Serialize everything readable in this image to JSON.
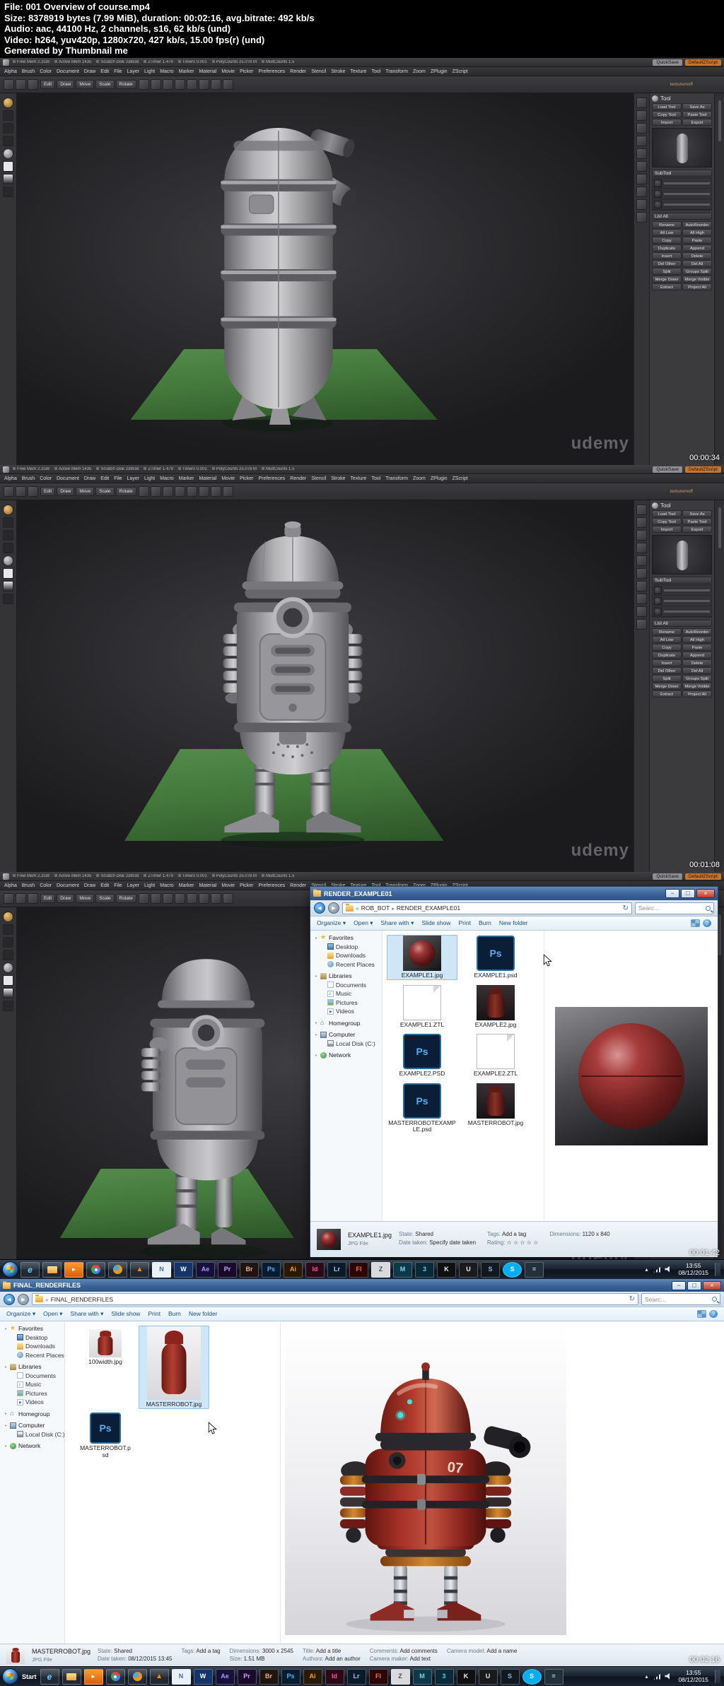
{
  "header": {
    "lines": [
      "File: 001 Overview of course.mp4",
      "Size: 8378919 bytes (7.99 MiB), duration: 00:02:16, avg.bitrate: 492 kb/s",
      "Audio: aac, 44100 Hz, 2 channels, s16, 62 kb/s (und)",
      "Video: h264, yuv420p, 1280x720, 427 kb/s, 15.00 fps(r) (und)",
      "Generated by Thumbnail me"
    ]
  },
  "frames": {
    "f1": {
      "timestamp": "00:00:34"
    },
    "f2": {
      "timestamp": "00:01:08"
    },
    "f3": {
      "timestamp": "00:01:42"
    },
    "f4": {
      "timestamp": "00:02:16"
    }
  },
  "zbrush": {
    "info": [
      "Free Mem 2.2GB",
      "Active Mem 1435",
      "Scratch Disk 238GB",
      "ZTimer 1.479",
      "Timers 0.001",
      "PolyCounts 25.078 M",
      "MultCounts 1.5"
    ],
    "chips": [
      {
        "t": "QuickSave",
        "cls": "grey",
        "n": "quicksave-button"
      },
      {
        "t": "DefaultZScript",
        "cls": "orange",
        "n": "default-zscript-button"
      }
    ],
    "menus": [
      "Alpha",
      "Brush",
      "Color",
      "Document",
      "Draw",
      "Edit",
      "File",
      "Layer",
      "Light",
      "Macro",
      "Marker",
      "Material",
      "Movie",
      "Picker",
      "Preferences",
      "Render",
      "Stencil",
      "Stroke",
      "Texture",
      "Tool",
      "Transform",
      "Zoom",
      "ZPlugin",
      "ZScript"
    ],
    "shelf_icons_a": [
      "projection-master-icon",
      "lightbox-icon",
      "quicksketch-icon"
    ],
    "shelf_buttons": [
      {
        "t": "Edit",
        "n": "edit-mode-button"
      },
      {
        "t": "Draw",
        "n": "draw-button"
      },
      {
        "t": "Move",
        "n": "move-button"
      },
      {
        "t": "Scale",
        "n": "scale-button"
      },
      {
        "t": "Rotate",
        "n": "rotate-button"
      }
    ],
    "shelf_icons_b": [
      "symmetry-icon",
      "polyframe-icon",
      "matcap-icon",
      "gradient-icon",
      "material-thumb-icon",
      "texture-thumb-icon",
      "alpha-thumb-icon",
      "stroke-thumb-icon"
    ],
    "texture_label": "texturemoff",
    "watermark": "udemy",
    "left_shelf": [
      {
        "n": "brush-icon",
        "cls": "gold"
      },
      {
        "n": "stroke-icon",
        "cls": "dark"
      },
      {
        "n": "alpha-icon",
        "cls": "dark"
      },
      {
        "n": "texture-icon",
        "cls": "dark"
      },
      {
        "n": "material-icon",
        "cls": "matcap"
      },
      {
        "n": "color-swatch-main",
        "cls": "white"
      },
      {
        "n": "color-gradient-swatch",
        "cls": "grad"
      },
      {
        "n": "color-picker-icon",
        "cls": "dark"
      }
    ],
    "right_shelf": [
      "scroll-icon",
      "zoom-icon",
      "actual-size-icon",
      "aa-half-icon",
      "perspective-icon",
      "floor-grid-icon",
      "local-symmetry-icon",
      "transparency-icon",
      "ghost-icon",
      "solo-icon"
    ],
    "tool": {
      "title": "Tool",
      "buttons": [
        "Load Tool",
        "Save As",
        "Copy Tool",
        "Paste Tool",
        "Import",
        "Export"
      ],
      "subtool_title": "SubTool",
      "subtools": [
        "subtool-slot-1",
        "subtool-slot-2",
        "subtool-slot-3"
      ],
      "list_all": "List All",
      "subtool_buttons": [
        "Rename",
        "AutoReorder",
        "All Low",
        "All High",
        "Copy",
        "Paste",
        "Duplicate",
        "Append",
        "Insert",
        "Delete",
        "Del Other",
        "Del All",
        "Split",
        "Groups Split",
        "Merge Down",
        "Merge Visible",
        "Extract",
        "Project All"
      ]
    }
  },
  "nav": [
    {
      "label": "Favorites",
      "cls": "root",
      "icon": "star-icon"
    },
    {
      "label": "Desktop",
      "cls": "child",
      "icon": "desktop-icon"
    },
    {
      "label": "Downloads",
      "cls": "child",
      "icon": "downloads-icon"
    },
    {
      "label": "Recent Places",
      "cls": "child",
      "icon": "recent-icon"
    },
    {
      "label": "Libraries",
      "cls": "root",
      "icon": "libraries-icon"
    },
    {
      "label": "Documents",
      "cls": "child",
      "icon": "documents-icon"
    },
    {
      "label": "Music",
      "cls": "child",
      "icon": "music-icon"
    },
    {
      "label": "Pictures",
      "cls": "child",
      "icon": "pictures-icon"
    },
    {
      "label": "Videos",
      "cls": "child",
      "icon": "videos-icon"
    },
    {
      "label": "Homegroup",
      "cls": "root",
      "icon": "homegroup-icon"
    },
    {
      "label": "Computer",
      "cls": "root",
      "icon": "computer-icon"
    },
    {
      "label": "Local Disk (C:)",
      "cls": "child",
      "icon": "disk-icon"
    },
    {
      "label": "Network",
      "cls": "root",
      "icon": "network-icon"
    }
  ],
  "explorer1": {
    "title": "RENDER_EXAMPLE01",
    "crumb_prefix": "«",
    "crumbs": [
      {
        "t": "ROB_BOT"
      },
      {
        "t": "RENDER_EXAMPLE01"
      }
    ],
    "search": "Searc...",
    "toolbar": [
      "Organize ▾",
      "Open ▾",
      "Share with ▾",
      "Slide show",
      "Print",
      "Burn",
      "New folder"
    ],
    "files": [
      {
        "name": "EXAMPLE1.jpg",
        "kind": "art-sphere",
        "badge": "",
        "selected": true
      },
      {
        "name": "EXAMPLE1.psd",
        "kind": "art-psd",
        "badge": "Ps",
        "selected": false
      },
      {
        "name": "EXAMPLE1.ZTL",
        "kind": "art-ztl",
        "badge": "",
        "selected": false
      },
      {
        "name": "EXAMPLE2.jpg",
        "kind": "art-robot-dark",
        "badge": "",
        "selected": false
      },
      {
        "name": "EXAMPLE2.PSD",
        "kind": "art-psd",
        "badge": "Ps",
        "selected": false
      },
      {
        "name": "EXAMPLE2.ZTL",
        "kind": "art-ztl",
        "badge": "",
        "selected": false
      },
      {
        "name": "MASTERROBOTEXAMPLE.psd",
        "kind": "art-psd",
        "badge": "Ps",
        "selected": false
      },
      {
        "name": "MASTERROBOT.jpg",
        "kind": "art-robot-dark",
        "badge": "",
        "selected": false
      }
    ],
    "details": {
      "name": "EXAMPLE1.jpg",
      "type": "JPG File",
      "fields": [
        {
          "l": "State:",
          "v": "Shared"
        },
        {
          "l": "Date taken:",
          "v": "Specify date taken"
        },
        {
          "l": "Tags:",
          "v": "Add a tag"
        },
        {
          "l": "Rating:",
          "v": "☆ ☆ ☆ ☆ ☆"
        },
        {
          "l": "Dimensions:",
          "v": "1120 x 840"
        }
      ]
    }
  },
  "explorer2": {
    "title": "FINAL_RENDERFILES",
    "crumb_prefix": "«",
    "crumbs": [
      {
        "t": "FINAL_RENDERFILES"
      }
    ],
    "search": "Searc...",
    "toolbar": [
      "Organize ▾",
      "Open ▾",
      "Share with ▾",
      "Slide show",
      "Print",
      "Burn",
      "New folder"
    ],
    "files": [
      {
        "name": "100width.jpg",
        "kind": "art-robot-light",
        "badge": "",
        "cls": "t-small",
        "selected": false
      },
      {
        "name": "MASTERROBOT.jpg",
        "kind": "art-robot-light",
        "badge": "",
        "cls": "t-big",
        "selected": true
      },
      {
        "name": "MASTERROBOT.psd",
        "kind": "art-psd",
        "badge": "Ps",
        "cls": "t-psd",
        "selected": false
      }
    ],
    "details": {
      "name": "MASTERROBOT.jpg",
      "type": "JPG File",
      "fields": [
        {
          "l": "State:",
          "v": "Shared"
        },
        {
          "l": "Date taken:",
          "v": "08/12/2015 13:45"
        },
        {
          "l": "Tags:",
          "v": "Add a tag"
        },
        {
          "l": "",
          "v": ""
        },
        {
          "l": "Dimensions:",
          "v": "3000 x 2545"
        },
        {
          "l": "Size:",
          "v": "1.51 MB"
        },
        {
          "l": "Title:",
          "v": "Add a title"
        },
        {
          "l": "Authors:",
          "v": "Add an author"
        },
        {
          "l": "Comments:",
          "v": "Add comments"
        },
        {
          "l": "Camera maker:",
          "v": "Add text"
        },
        {
          "l": "Camera model:",
          "v": "Add a name"
        }
      ]
    }
  },
  "render": {
    "decal": "07"
  },
  "taskbar": {
    "start_label": "Start",
    "time": "13:55",
    "date": "08/12/2015",
    "icons": [
      {
        "n": "internet-explorer-icon",
        "t": "e",
        "cls": "ie"
      },
      {
        "n": "windows-explorer-icon",
        "t": "",
        "cls": "folder"
      },
      {
        "n": "media-player-icon",
        "t": "►",
        "cls": "wmp"
      },
      {
        "n": "chrome-icon",
        "t": "",
        "cls": "chrome"
      },
      {
        "n": "firefox-icon",
        "t": "",
        "cls": "firefox"
      },
      {
        "n": "vlc-icon",
        "t": "▲",
        "cls": "vlc"
      },
      {
        "n": "notepad-icon",
        "t": "N",
        "cls": "notepad"
      },
      {
        "n": "word-icon",
        "t": "W",
        "cls": "word"
      },
      {
        "n": "after-effects-icon",
        "t": "Ae",
        "cls": "ae"
      },
      {
        "n": "premiere-icon",
        "t": "Pr",
        "cls": "pr"
      },
      {
        "n": "bridge-icon",
        "t": "Br",
        "cls": "br"
      },
      {
        "n": "photoshop-icon",
        "t": "Ps",
        "cls": "ps"
      },
      {
        "n": "illustrator-icon",
        "t": "Ai",
        "cls": "ai"
      },
      {
        "n": "indesign-icon",
        "t": "Id",
        "cls": "id"
      },
      {
        "n": "lightroom-icon",
        "t": "Lr",
        "cls": "lr"
      },
      {
        "n": "flash-icon",
        "t": "Fl",
        "cls": "fl"
      },
      {
        "n": "zbrush-icon",
        "t": "Z",
        "cls": "zbr"
      },
      {
        "n": "maya-icon",
        "t": "M",
        "cls": "maya"
      },
      {
        "n": "3ds-max-icon",
        "t": "3",
        "cls": "max"
      },
      {
        "n": "keyshot-icon",
        "t": "K",
        "cls": "ks"
      },
      {
        "n": "unity-icon",
        "t": "U",
        "cls": "unity"
      },
      {
        "n": "steam-icon",
        "t": "S",
        "cls": "steam"
      },
      {
        "n": "skype-icon",
        "t": "S",
        "cls": "skype"
      },
      {
        "n": "calculator-icon",
        "t": "=",
        "cls": "calc"
      }
    ],
    "tray": [
      {
        "n": "hidden-icons-chevron",
        "cls": "chev",
        "t": "▴"
      },
      {
        "n": "network-tray-icon",
        "cls": "ti-net",
        "t": ""
      },
      {
        "n": "volume-tray-icon",
        "cls": "ti-vol",
        "t": ""
      }
    ]
  }
}
